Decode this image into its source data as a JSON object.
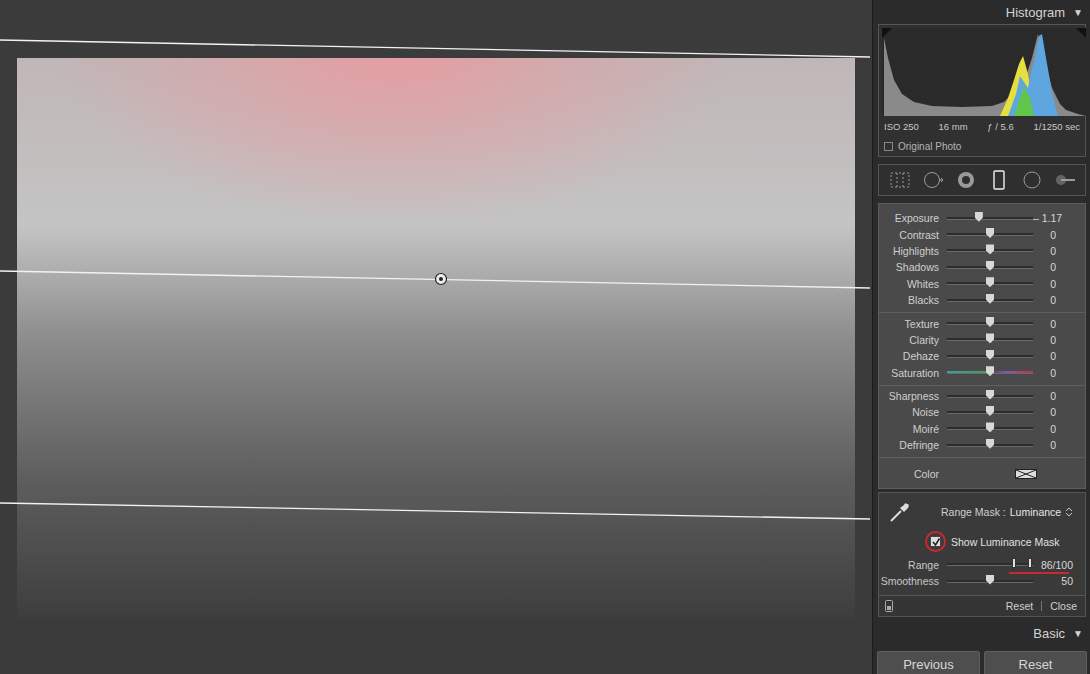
{
  "histogram": {
    "title": "Histogram",
    "toggle": "▼",
    "info": [
      "ISO 250",
      "16 mm",
      "ƒ / 5.6",
      "1/1250 sec"
    ],
    "original_photo": {
      "label": "Original Photo",
      "checked": false
    }
  },
  "photo": {
    "mask_shown": true
  },
  "tools": [
    {
      "kind": "crop",
      "selected": false
    },
    {
      "kind": "spot",
      "selected": false
    },
    {
      "kind": "redeye",
      "selected": false
    },
    {
      "kind": "graduated",
      "selected": true
    },
    {
      "kind": "radial",
      "selected": false
    },
    {
      "kind": "brush",
      "selected": false
    }
  ],
  "groups": [
    {
      "sliders": [
        {
          "label": "Exposure",
          "level": 0.37,
          "reading": "– 1.17",
          "kind": "plain"
        },
        {
          "label": "Contrast",
          "level": 0.5,
          "reading": "0",
          "kind": "plain"
        },
        {
          "label": "Highlights",
          "level": 0.5,
          "reading": "0",
          "kind": "plain"
        },
        {
          "label": "Shadows",
          "level": 0.5,
          "reading": "0",
          "kind": "plain"
        },
        {
          "label": "Whites",
          "level": 0.5,
          "reading": "0",
          "kind": "plain"
        },
        {
          "label": "Blacks",
          "level": 0.5,
          "reading": "0",
          "kind": "plain"
        }
      ]
    },
    {
      "sliders": [
        {
          "label": "Texture",
          "level": 0.5,
          "reading": "0",
          "kind": "plain"
        },
        {
          "label": "Clarity",
          "level": 0.5,
          "reading": "0",
          "kind": "plain"
        },
        {
          "label": "Dehaze",
          "level": 0.5,
          "reading": "0",
          "kind": "plain"
        },
        {
          "label": "Saturation",
          "level": 0.5,
          "reading": "0",
          "kind": "hue"
        }
      ]
    },
    {
      "sliders": [
        {
          "label": "Sharpness",
          "level": 0.5,
          "reading": "0",
          "kind": "plain"
        },
        {
          "label": "Noise",
          "level": 0.5,
          "reading": "0",
          "kind": "plain"
        },
        {
          "label": "Moiré",
          "level": 0.5,
          "reading": "0",
          "kind": "plain"
        },
        {
          "label": "Defringe",
          "level": 0.5,
          "reading": "0",
          "kind": "plain"
        }
      ]
    }
  ],
  "color": {
    "label": "Color",
    "set": false
  },
  "range_mask": {
    "label": "Range Mask :",
    "value": "Luminance"
  },
  "show_mask": {
    "label": "Show Luminance Mask",
    "checked": true,
    "annotated": true
  },
  "range": {
    "label": "Range",
    "low": 0.86,
    "high": 1.0,
    "reading": "86/100",
    "annotated": true
  },
  "smoothness": {
    "label": "Smoothness",
    "level": 0.5,
    "reading": "50"
  },
  "mask_footer": {
    "buttons": [
      "Reset",
      "Close"
    ]
  },
  "basic": {
    "title": "Basic",
    "toggle": "▼"
  },
  "buttons": [
    "Previous",
    "Reset"
  ]
}
